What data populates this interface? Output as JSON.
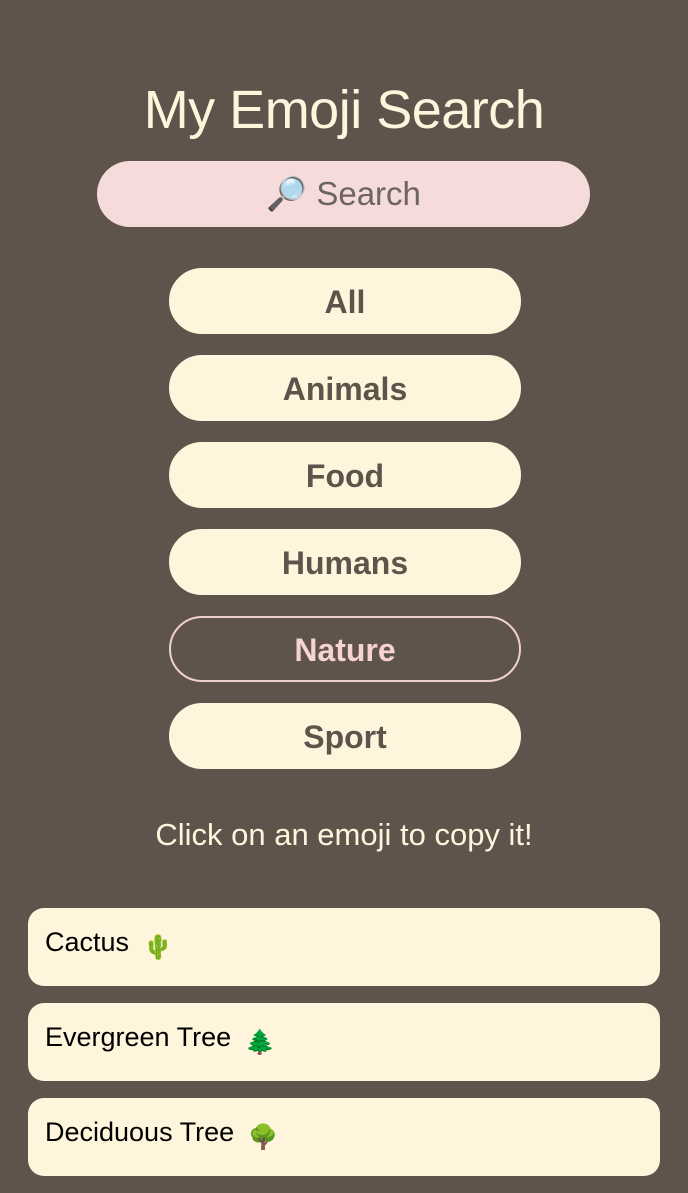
{
  "app": {
    "title": "My Emoji Search"
  },
  "search": {
    "placeholder": "🔎 Search",
    "value": ""
  },
  "categories": [
    {
      "label": "All",
      "active": false
    },
    {
      "label": "Animals",
      "active": false
    },
    {
      "label": "Food",
      "active": false
    },
    {
      "label": "Humans",
      "active": false
    },
    {
      "label": "Nature",
      "active": true
    },
    {
      "label": "Sport",
      "active": false
    }
  ],
  "hint": "Click on an emoji to copy it!",
  "results": [
    {
      "name": "Cactus",
      "emoji": "🌵"
    },
    {
      "name": "Evergreen Tree",
      "emoji": "🌲"
    },
    {
      "name": "Deciduous Tree",
      "emoji": "🌳"
    }
  ],
  "colors": {
    "background": "#5f544b",
    "cream": "#fff5dc",
    "pink": "#f6dbdb",
    "active_text": "#f6d3d3"
  }
}
